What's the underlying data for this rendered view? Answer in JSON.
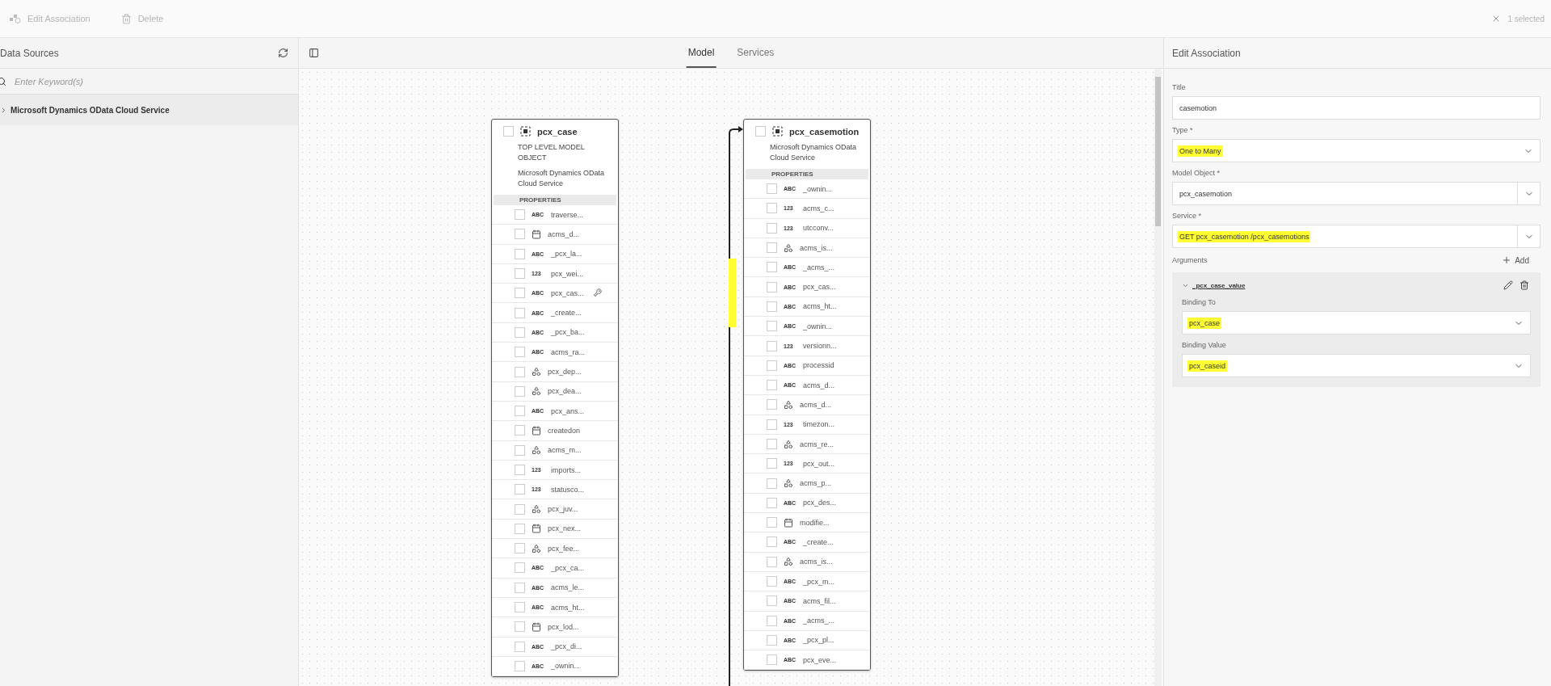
{
  "toolbar": {
    "actions": [
      {
        "kind": "edit",
        "label": "Edit Association",
        "disabled": true
      },
      {
        "kind": "delete",
        "label": "Delete",
        "disabled": true
      }
    ],
    "selection": "1 selected"
  },
  "left_panel": {
    "title": "Data Sources",
    "search": {
      "placeholder": "Enter Keyword(s)"
    },
    "tree": [
      {
        "label": "Microsoft Dynamics OData Cloud Service",
        "expanded": false
      }
    ]
  },
  "tabs": [
    {
      "label": "Model",
      "selected": true
    },
    {
      "label": "Services",
      "selected": false
    }
  ],
  "cards": [
    {
      "title": "pcx_case",
      "checked": false,
      "subtitle": "TOP LEVEL MODEL OBJECT",
      "source": "Microsoft Dynamics OData Cloud Service",
      "section": "PROPERTIES",
      "properties": [
        {
          "kind": "badge",
          "badge": "ABC",
          "name": "traverse...",
          "checked": false,
          "key": false
        },
        {
          "kind": "date",
          "name": "acms_d...",
          "checked": false,
          "key": false
        },
        {
          "kind": "badge",
          "badge": "ABC",
          "name": "_pcx_la...",
          "checked": false,
          "key": false
        },
        {
          "kind": "badge",
          "badge": "123",
          "name": "pcx_wei...",
          "checked": false,
          "key": false
        },
        {
          "kind": "badge",
          "badge": "ABC",
          "name": "pcx_cas...",
          "checked": false,
          "key": true
        },
        {
          "kind": "badge",
          "badge": "ABC",
          "name": "_create...",
          "checked": false,
          "key": false
        },
        {
          "kind": "badge",
          "badge": "ABC",
          "name": "_pcx_ba...",
          "checked": false,
          "key": false
        },
        {
          "kind": "badge",
          "badge": "ABC",
          "name": "acms_ra...",
          "checked": false,
          "key": false
        },
        {
          "kind": "option",
          "name": "pcx_dep...",
          "checked": false,
          "key": false
        },
        {
          "kind": "option",
          "name": "pcx_dea...",
          "checked": false,
          "key": false
        },
        {
          "kind": "badge",
          "badge": "ABC",
          "name": "pcx_ans...",
          "checked": false,
          "key": false
        },
        {
          "kind": "date",
          "name": "createdon",
          "checked": false,
          "key": false
        },
        {
          "kind": "option",
          "name": "acms_m...",
          "checked": false,
          "key": false
        },
        {
          "kind": "badge",
          "badge": "123",
          "name": "imports...",
          "checked": false,
          "key": false
        },
        {
          "kind": "badge",
          "badge": "123",
          "name": "statusco...",
          "checked": false,
          "key": false
        },
        {
          "kind": "option",
          "name": "pcx_juv...",
          "checked": false,
          "key": false
        },
        {
          "kind": "date",
          "name": "pcx_nex...",
          "checked": false,
          "key": false
        },
        {
          "kind": "option",
          "name": "pcx_fee...",
          "checked": false,
          "key": false
        },
        {
          "kind": "badge",
          "badge": "ABC",
          "name": "_pcx_ca...",
          "checked": false,
          "key": false
        },
        {
          "kind": "badge",
          "badge": "ABC",
          "name": "acms_le...",
          "checked": false,
          "key": false
        },
        {
          "kind": "badge",
          "badge": "ABC",
          "name": "acms_ht...",
          "checked": false,
          "key": false
        },
        {
          "kind": "date",
          "name": "pcx_lod...",
          "checked": false,
          "key": false
        },
        {
          "kind": "badge",
          "badge": "ABC",
          "name": "_pcx_di...",
          "checked": false,
          "key": false
        },
        {
          "kind": "badge",
          "badge": "ABC",
          "name": "_ownin...",
          "checked": false,
          "key": false
        }
      ]
    },
    {
      "title": "pcx_casemotion",
      "checked": false,
      "source": "Microsoft Dynamics OData Cloud Service",
      "section": "PROPERTIES",
      "properties": [
        {
          "kind": "badge",
          "badge": "ABC",
          "name": "_ownin...",
          "checked": false,
          "key": false
        },
        {
          "kind": "badge",
          "badge": "123",
          "name": "acms_c...",
          "checked": false,
          "key": false
        },
        {
          "kind": "badge",
          "badge": "123",
          "name": "utcconv...",
          "checked": false,
          "key": false
        },
        {
          "kind": "option",
          "name": "acms_is...",
          "checked": false,
          "key": false
        },
        {
          "kind": "badge",
          "badge": "ABC",
          "name": "_acms_...",
          "checked": false,
          "key": false
        },
        {
          "kind": "badge",
          "badge": "ABC",
          "name": "pcx_cas...",
          "checked": false,
          "key": false
        },
        {
          "kind": "badge",
          "badge": "ABC",
          "name": "acms_ht...",
          "checked": false,
          "key": false
        },
        {
          "kind": "badge",
          "badge": "ABC",
          "name": "_ownin...",
          "checked": false,
          "key": false
        },
        {
          "kind": "badge",
          "badge": "123",
          "name": "versionn...",
          "checked": false,
          "key": false
        },
        {
          "kind": "badge",
          "badge": "ABC",
          "name": "processid",
          "checked": false,
          "key": false
        },
        {
          "kind": "badge",
          "badge": "ABC",
          "name": "acms_d...",
          "checked": false,
          "key": false
        },
        {
          "kind": "option",
          "name": "acms_d...",
          "checked": false,
          "key": false
        },
        {
          "kind": "badge",
          "badge": "123",
          "name": "timezon...",
          "checked": false,
          "key": false
        },
        {
          "kind": "option",
          "name": "acms_re...",
          "checked": false,
          "key": false
        },
        {
          "kind": "badge",
          "badge": "123",
          "name": "pcx_out...",
          "checked": false,
          "key": false
        },
        {
          "kind": "option",
          "name": "acms_p...",
          "checked": false,
          "key": false
        },
        {
          "kind": "badge",
          "badge": "ABC",
          "name": "pcx_des...",
          "checked": false,
          "key": false
        },
        {
          "kind": "date",
          "name": "modifie...",
          "checked": false,
          "key": false
        },
        {
          "kind": "badge",
          "badge": "ABC",
          "name": "_create...",
          "checked": false,
          "key": false
        },
        {
          "kind": "option",
          "name": "acms_is...",
          "checked": false,
          "key": false
        },
        {
          "kind": "badge",
          "badge": "ABC",
          "name": "_pcx_m...",
          "checked": false,
          "key": false
        },
        {
          "kind": "badge",
          "badge": "ABC",
          "name": "acms_fil...",
          "checked": false,
          "key": false
        },
        {
          "kind": "badge",
          "badge": "ABC",
          "name": "_acms_...",
          "checked": false,
          "key": false
        },
        {
          "kind": "badge",
          "badge": "ABC",
          "name": "_pcx_pl...",
          "checked": false,
          "key": false
        },
        {
          "kind": "badge",
          "badge": "ABC",
          "name": "pcx_eve...",
          "checked": false,
          "key": false
        }
      ]
    }
  ],
  "edit_panel": {
    "title": "Edit Association",
    "fields": [
      {
        "kind": "text",
        "label": "Title",
        "value": "casemotion",
        "highlighted": false
      },
      {
        "kind": "select",
        "label": "Type *",
        "value": "One to Many",
        "highlighted": true
      },
      {
        "kind": "combo",
        "label": "Model Object *",
        "value": "pcx_casemotion",
        "highlighted": false
      },
      {
        "kind": "combo",
        "label": "Service *",
        "value": "GET pcx_casemotion /pcx_casemotions",
        "highlighted": true
      }
    ],
    "arguments": {
      "label": "Arguments",
      "add": "Add",
      "items": [
        {
          "name": "_pcx_case_value",
          "expanded": true,
          "fields": [
            {
              "label": "Binding To",
              "value": "pcx_case",
              "highlighted": true
            },
            {
              "label": "Binding Value",
              "value": "pcx_caseid",
              "highlighted": true
            }
          ]
        }
      ]
    }
  }
}
